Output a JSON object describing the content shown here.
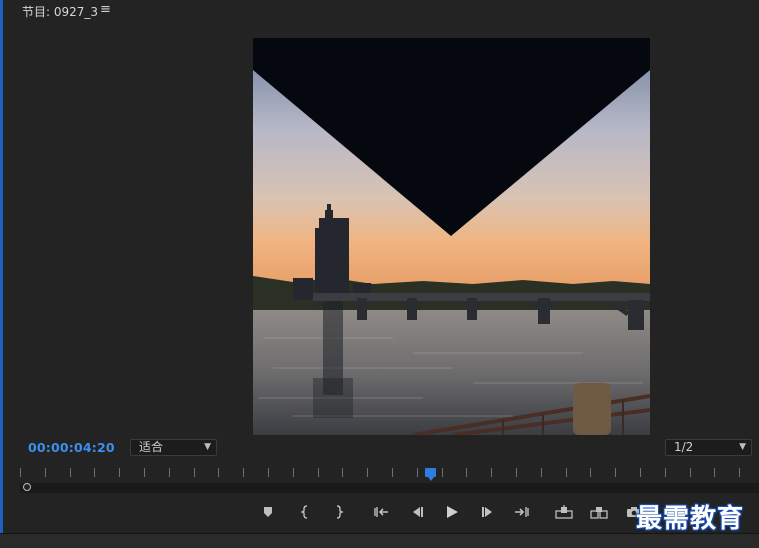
{
  "header": {
    "panel_title": "节目: 0927_3",
    "menu_icon": "hamburger-menu-icon"
  },
  "viewer": {
    "content": "sunset-river-bridge-video-frame"
  },
  "footer": {
    "timecode": "00:00:04:20",
    "zoom_select": "适合",
    "resolution_select": "1/2"
  },
  "playback": {
    "playhead_position_fraction": 0.56
  },
  "controls": [
    {
      "name": "add-marker-button",
      "icon": "marker-icon"
    },
    {
      "name": "mark-in-button",
      "icon": "mark-in-icon"
    },
    {
      "name": "mark-out-button",
      "icon": "mark-out-icon"
    },
    {
      "name": "go-to-in-button",
      "icon": "go-to-in-icon"
    },
    {
      "name": "step-back-button",
      "icon": "step-back-icon"
    },
    {
      "name": "play-button",
      "icon": "play-icon"
    },
    {
      "name": "step-forward-button",
      "icon": "step-forward-icon"
    },
    {
      "name": "go-to-out-button",
      "icon": "go-to-out-icon"
    },
    {
      "name": "lift-button",
      "icon": "lift-icon"
    },
    {
      "name": "extract-button",
      "icon": "extract-icon"
    },
    {
      "name": "export-frame-button",
      "icon": "camera-icon"
    }
  ],
  "watermark": "最需教育",
  "colors": {
    "accent": "#3d8ef0",
    "panel_bg": "#232323",
    "playhead": "#2f7de0"
  }
}
